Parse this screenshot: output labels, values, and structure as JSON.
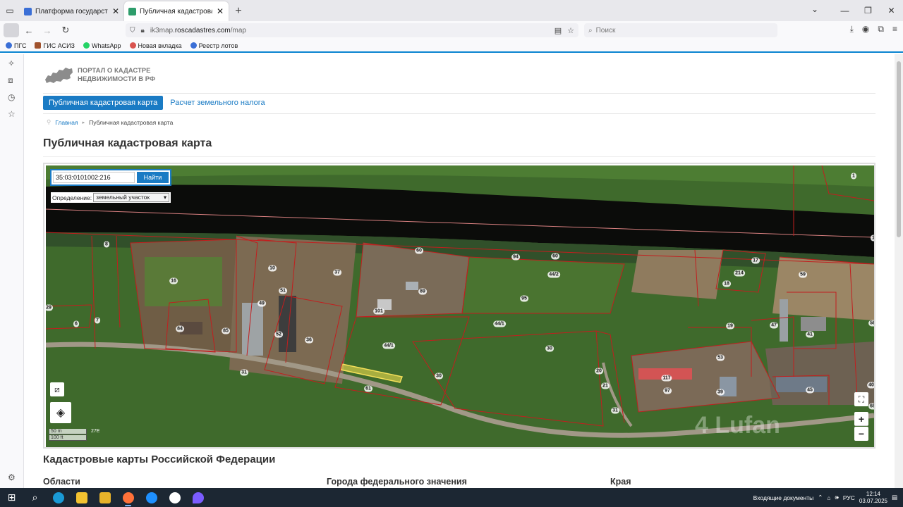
{
  "browser": {
    "tabs": [
      {
        "title": "Платформа государственных с",
        "icon_color": "#3b6fd6",
        "active": false
      },
      {
        "title": "Публичная кадастровая карта",
        "icon_color": "#2e9d6b",
        "active": true
      }
    ],
    "url_prefix": "ik3map.",
    "url_host": "roscadastres.com",
    "url_path": "/map",
    "search_placeholder": "Поиск",
    "bookmarks": [
      {
        "label": "ПГС",
        "color": "#3b6fd6"
      },
      {
        "label": "ГИС АСИЗ",
        "color": "#a0522d"
      },
      {
        "label": "WhatsApp",
        "color": "#25d366"
      },
      {
        "label": "Новая вкладка",
        "color": "#d9534f"
      },
      {
        "label": "Реестр лотов",
        "color": "#3b6fd6"
      }
    ]
  },
  "site": {
    "logo_line1": "ПОРТАЛ О КАДАСТРЕ",
    "logo_line2": "НЕДВИЖИМОСТИ В РФ",
    "menu_active": "Публичная кадастровая карта",
    "menu_link": "Расчет земельного налога",
    "breadcrumb_home": "Главная",
    "breadcrumb_current": "Публичная кадастровая карта",
    "page_title": "Публичная кадастровая карта"
  },
  "map": {
    "search_value": "35:03:0101002:216",
    "find_label": "Найти",
    "definition_label": "Определение:",
    "definition_value": "земельный участок",
    "scale_m": "50 m",
    "scale_ft": "100 ft",
    "coord_text": "27E",
    "watermark": "4 Lufan",
    "zoom_in": "+",
    "zoom_out": "−",
    "parcels": [
      "8",
      "16",
      "10",
      "37",
      "29",
      "6",
      "7",
      "84",
      "85",
      "49",
      "31",
      "36",
      "51",
      "52",
      "60",
      "89",
      "94",
      "60",
      "44/2",
      "95",
      "44/1",
      "44/1",
      "61",
      "30",
      "30",
      "20",
      "21",
      "31",
      "17",
      "214",
      "18",
      "59",
      "19",
      "47",
      "41",
      "53",
      "117",
      "97",
      "39",
      "45",
      "40",
      "1",
      "58",
      "1",
      "101",
      "65"
    ]
  },
  "sections": {
    "cadastral_title": "Кадастровые карты Российской Федерации",
    "col1": "Области",
    "col2": "Города федерального значения",
    "col3": "Края"
  },
  "taskbar": {
    "tray_text": "Входящие документы",
    "lang": "РУС",
    "time": "12:14",
    "date": "03.07.2025"
  }
}
